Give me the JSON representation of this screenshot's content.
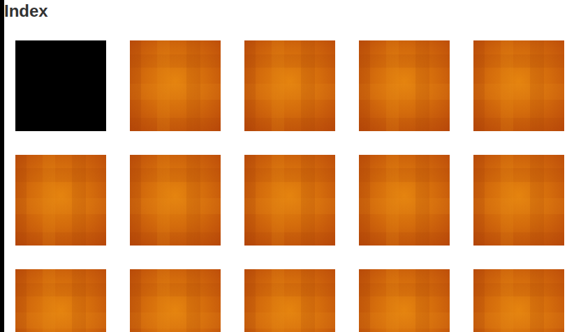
{
  "page": {
    "title": "Index"
  },
  "tiles": [
    {
      "kind": "blank"
    },
    {
      "kind": "image"
    },
    {
      "kind": "image"
    },
    {
      "kind": "image"
    },
    {
      "kind": "image"
    },
    {
      "kind": "image"
    },
    {
      "kind": "image"
    },
    {
      "kind": "image"
    },
    {
      "kind": "image"
    },
    {
      "kind": "image"
    },
    {
      "kind": "image"
    },
    {
      "kind": "image"
    },
    {
      "kind": "image"
    },
    {
      "kind": "image"
    },
    {
      "kind": "image"
    }
  ]
}
